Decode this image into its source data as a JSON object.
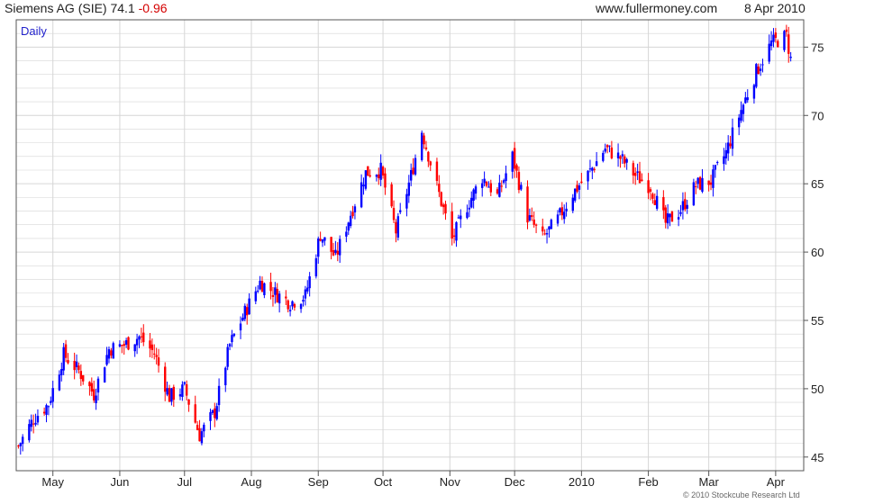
{
  "header": {
    "symbol": "Siemens AG (SIE)",
    "last": "74.1",
    "change": "-0.96",
    "site": "www.fullermoney.com",
    "date": "8 Apr 2010"
  },
  "footer": {
    "copyright": "© 2010 Stockcube Research Ltd"
  },
  "colors": {
    "up": "#0000ff",
    "down": "#ff0000",
    "grid": "#d6d6d6",
    "frame": "#555555",
    "label": "#2222cc"
  },
  "chart_data": {
    "type": "candlestick",
    "period_label": "Daily",
    "ylim": [
      44,
      77
    ],
    "y_ticks": [
      45,
      50,
      55,
      60,
      65,
      70,
      75
    ],
    "x_ticks": [
      {
        "label": "May",
        "date": "2009-05-01"
      },
      {
        "label": "Jun",
        "date": "2009-06-01"
      },
      {
        "label": "Jul",
        "date": "2009-07-01"
      },
      {
        "label": "Aug",
        "date": "2009-08-01"
      },
      {
        "label": "Sep",
        "date": "2009-09-01"
      },
      {
        "label": "Oct",
        "date": "2009-10-01"
      },
      {
        "label": "Nov",
        "date": "2009-11-01"
      },
      {
        "label": "Dec",
        "date": "2009-12-01"
      },
      {
        "label": "2010",
        "date": "2010-01-01"
      },
      {
        "label": "Feb",
        "date": "2010-02-01"
      },
      {
        "label": "Mar",
        "date": "2010-03-01"
      },
      {
        "label": "Apr",
        "date": "2010-04-01"
      }
    ],
    "x_range": [
      "2009-04-14",
      "2010-04-14"
    ],
    "close_series": [
      [
        "2009-04-15",
        45.8
      ],
      [
        "2009-04-22",
        47.8
      ],
      [
        "2009-04-29",
        48.9
      ],
      [
        "2009-05-06",
        52.5
      ],
      [
        "2009-05-13",
        51.3
      ],
      [
        "2009-05-20",
        49.6
      ],
      [
        "2009-05-27",
        52.9
      ],
      [
        "2009-06-03",
        53.2
      ],
      [
        "2009-06-10",
        53.8
      ],
      [
        "2009-06-17",
        52.6
      ],
      [
        "2009-06-24",
        49.4
      ],
      [
        "2009-07-01",
        50.0
      ],
      [
        "2009-07-08",
        46.6
      ],
      [
        "2009-07-15",
        48.3
      ],
      [
        "2009-07-22",
        53.2
      ],
      [
        "2009-07-29",
        55.6
      ],
      [
        "2009-08-05",
        57.8
      ],
      [
        "2009-08-12",
        57.0
      ],
      [
        "2009-08-19",
        56.3
      ],
      [
        "2009-08-26",
        56.8
      ],
      [
        "2009-09-02",
        61.3
      ],
      [
        "2009-09-09",
        59.6
      ],
      [
        "2009-09-16",
        62.8
      ],
      [
        "2009-09-23",
        65.8
      ],
      [
        "2009-09-30",
        66.0
      ],
      [
        "2009-10-07",
        61.5
      ],
      [
        "2009-10-14",
        65.6
      ],
      [
        "2009-10-19",
        68.9
      ],
      [
        "2009-10-26",
        64.8
      ],
      [
        "2009-11-02",
        60.9
      ],
      [
        "2009-11-09",
        63.4
      ],
      [
        "2009-11-16",
        65.5
      ],
      [
        "2009-11-23",
        64.1
      ],
      [
        "2009-11-30",
        67.0
      ],
      [
        "2009-12-07",
        62.6
      ],
      [
        "2009-12-14",
        61.0
      ],
      [
        "2009-12-21",
        62.4
      ],
      [
        "2009-12-28",
        64.3
      ],
      [
        "2010-01-05",
        65.9
      ],
      [
        "2010-01-12",
        67.6
      ],
      [
        "2010-01-19",
        66.9
      ],
      [
        "2010-01-26",
        65.6
      ],
      [
        "2010-02-02",
        64.8
      ],
      [
        "2010-02-09",
        62.1
      ],
      [
        "2010-02-16",
        63.1
      ],
      [
        "2010-02-23",
        64.9
      ],
      [
        "2010-03-02",
        65.2
      ],
      [
        "2010-03-09",
        67.3
      ],
      [
        "2010-03-16",
        70.4
      ],
      [
        "2010-03-23",
        73.2
      ],
      [
        "2010-03-30",
        75.3
      ],
      [
        "2010-04-06",
        75.8
      ],
      [
        "2010-04-08",
        74.1
      ]
    ]
  }
}
